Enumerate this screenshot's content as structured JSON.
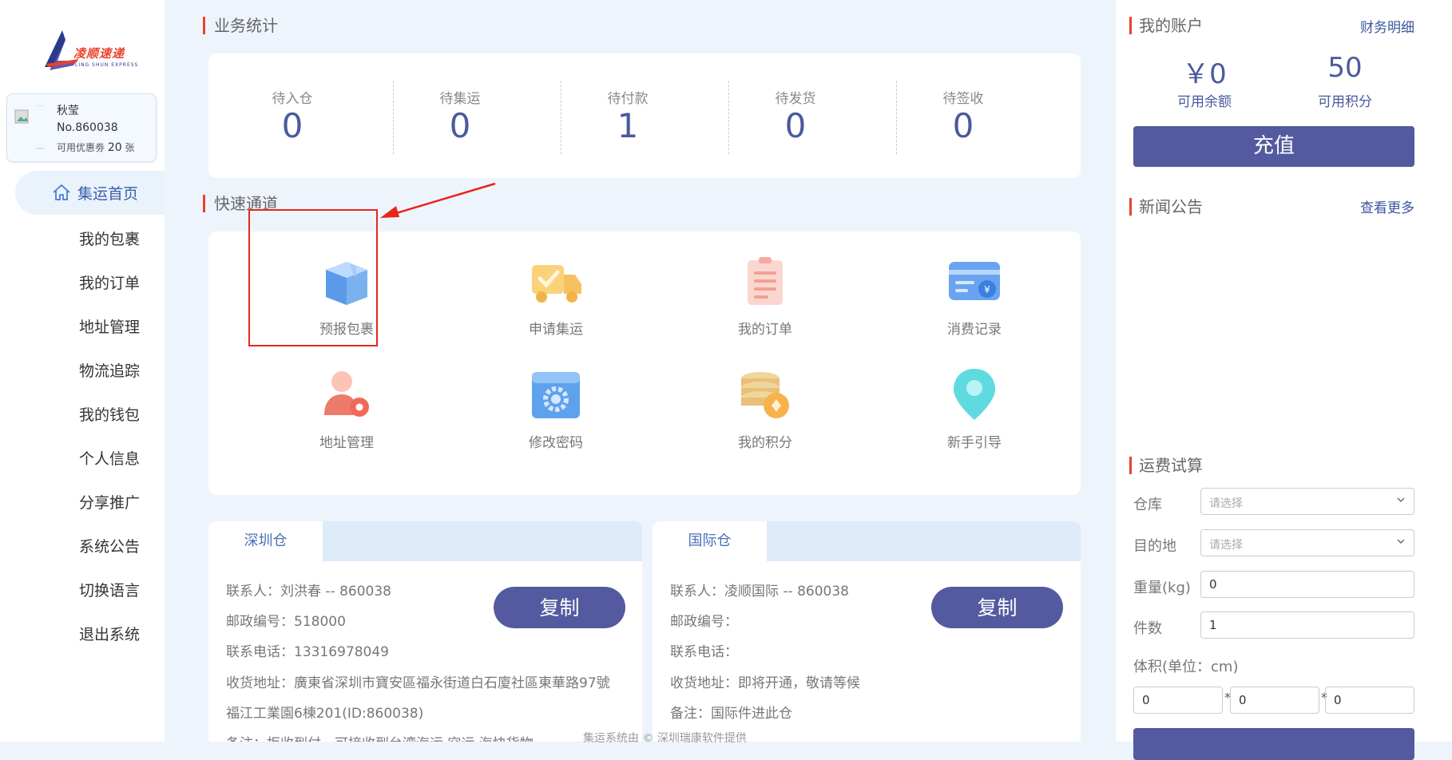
{
  "brand": {
    "name": "凌顺速递",
    "sub": "LING SHUN EXPRESS"
  },
  "user": {
    "name": "秋莹",
    "no": "No.860038",
    "coupon_prefix": "可用优惠劵",
    "coupon_count": "20",
    "coupon_suffix": "张"
  },
  "nav": {
    "active": "集运首页",
    "items": [
      "我的包裹",
      "我的订单",
      "地址管理",
      "物流追踪",
      "我的钱包",
      "个人信息",
      "分享推广",
      "系统公告",
      "切换语言",
      "退出系统"
    ]
  },
  "stats": {
    "title": "业务统计",
    "items": [
      {
        "label": "待入仓",
        "value": "0"
      },
      {
        "label": "待集运",
        "value": "0"
      },
      {
        "label": "待付款",
        "value": "1"
      },
      {
        "label": "待发货",
        "value": "0"
      },
      {
        "label": "待签收",
        "value": "0"
      }
    ]
  },
  "quick": {
    "title": "快速通道",
    "items": [
      {
        "label": "预报包裹",
        "icon": "package-box-icon"
      },
      {
        "label": "申请集运",
        "icon": "delivery-truck-icon"
      },
      {
        "label": "我的订单",
        "icon": "clipboard-list-icon"
      },
      {
        "label": "消费记录",
        "icon": "payment-card-icon"
      },
      {
        "label": "地址管理",
        "icon": "user-settings-icon"
      },
      {
        "label": "修改密码",
        "icon": "lock-gear-icon"
      },
      {
        "label": "我的积分",
        "icon": "coin-stack-icon"
      },
      {
        "label": "新手引导",
        "icon": "location-pin-icon"
      }
    ]
  },
  "warehouses": [
    {
      "tab": "深圳仓",
      "copy_label": "复制",
      "lines": [
        "联系人：刘洪春 -- 860038",
        "邮政编号：518000",
        "联系电话：13316978049",
        "收货地址：廣東省深圳市寶安區福永街道白石廈社區東華路97號",
        "福江工業園6棟201(ID:860038)",
        "备注：拒收到付，可接收到台湾海运,空运,海快货物"
      ]
    },
    {
      "tab": "国际仓",
      "copy_label": "复制",
      "lines": [
        "联系人：凌顺国际 -- 860038",
        "邮政编号：",
        "联系电话：",
        "收货地址：即将开通，敬请等候",
        "备注：国际件进此仓"
      ]
    }
  ],
  "footer": "集运系统由 © 深圳瑞康软件提供",
  "account": {
    "title": "我的账户",
    "link": "财务明细",
    "balance": "￥0",
    "balance_label": "可用余额",
    "points": "50",
    "points_label": "可用积分",
    "recharge": "充值"
  },
  "news": {
    "title": "新闻公告",
    "link": "查看更多"
  },
  "calc": {
    "title": "运费试算",
    "warehouse_label": "仓库",
    "warehouse_placeholder": "请选择",
    "dest_label": "目的地",
    "dest_placeholder": "请选择",
    "weight_label": "重量(kg)",
    "weight_value": "0",
    "count_label": "件数",
    "count_value": "1",
    "volume_label": "体积(单位：cm)",
    "l": "0",
    "w": "0",
    "h": "0",
    "star": "*"
  },
  "colors": {
    "accent": "#535a9f",
    "title_bar": "#e8432d",
    "highlight": "#e8261d"
  }
}
